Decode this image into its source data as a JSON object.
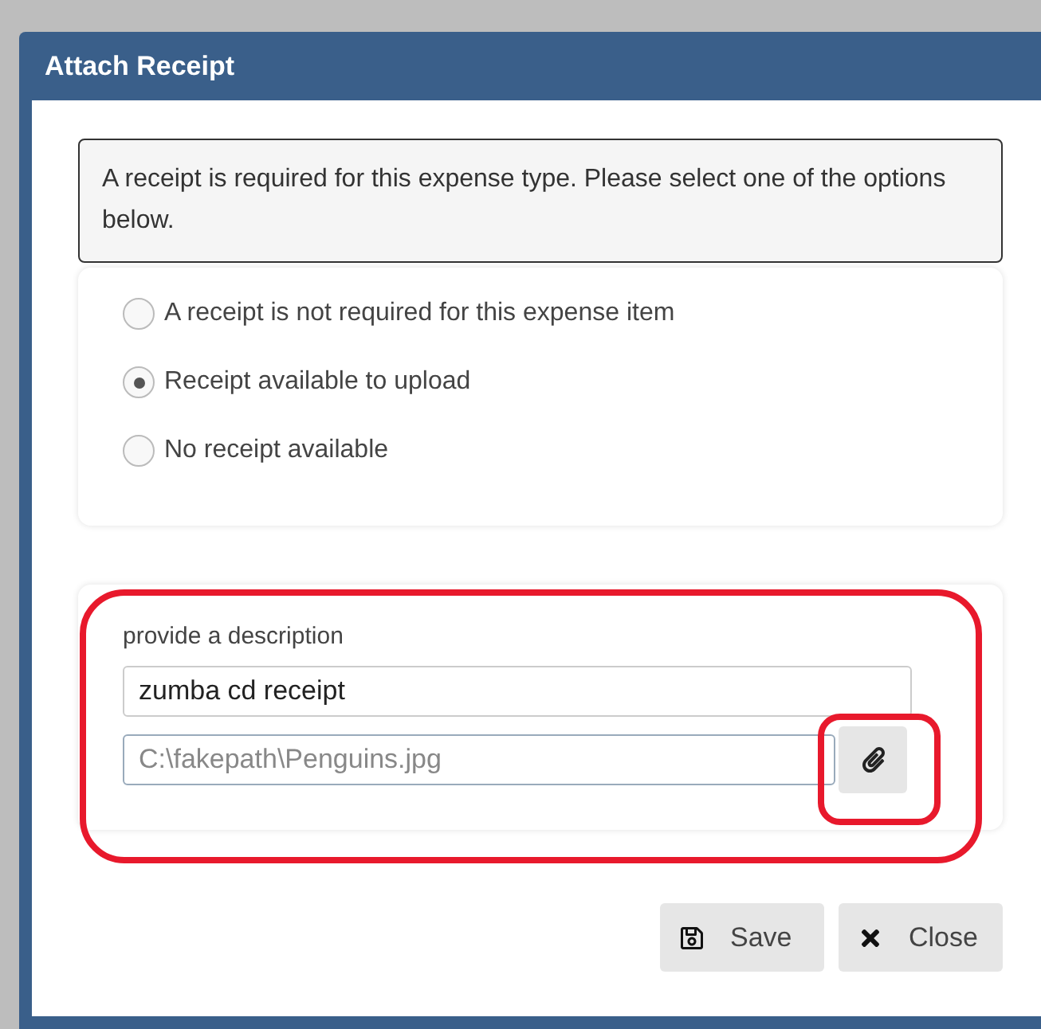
{
  "dialog": {
    "title": "Attach Receipt"
  },
  "message": "A receipt is required for this expense type. Please select one of the options below.",
  "options": [
    {
      "label": "A receipt is not required for this expense item",
      "selected": false
    },
    {
      "label": "Receipt available to upload",
      "selected": true
    },
    {
      "label": "No receipt available",
      "selected": false
    }
  ],
  "upload": {
    "label": "provide a description",
    "description": "zumba cd receipt",
    "file_path": "C:\\fakepath\\Penguins.jpg"
  },
  "buttons": [
    {
      "kind": "save",
      "label": "Save"
    },
    {
      "kind": "close",
      "label": "Close"
    }
  ]
}
